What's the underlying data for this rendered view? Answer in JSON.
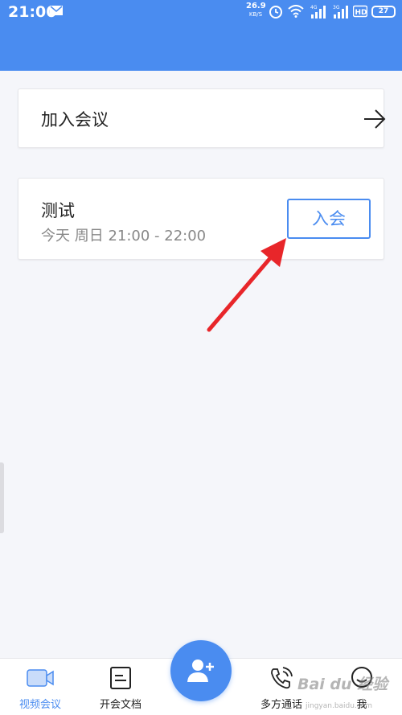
{
  "status_bar": {
    "time": "21:00",
    "net_speed": "26.9",
    "net_speed_unit": "KB/S",
    "battery": "27",
    "signal1_label": "4G",
    "signal2_label": "3G",
    "hd_label": "HD"
  },
  "join_card": {
    "label": "加入会议"
  },
  "meeting_card": {
    "title": "测试",
    "schedule": "今天 周日  21:00 - 22:00",
    "join_button": "入会"
  },
  "tab_bar": {
    "tabs": [
      {
        "label": "视频会议",
        "icon": "video-camera-icon",
        "active": true
      },
      {
        "label": "开会文档",
        "icon": "document-icon",
        "active": false
      },
      {
        "label": "多方通话",
        "icon": "phone-call-icon",
        "active": false
      },
      {
        "label": "我",
        "icon": "profile-icon",
        "active": false
      }
    ],
    "fab_icon": "add-user-icon"
  },
  "watermark": {
    "text": "Bai du 经验",
    "url": "jingyan.baidu.com"
  },
  "colors": {
    "primary": "#4a8cf0",
    "annotation": "#e8262a",
    "background": "#f5f6fa"
  }
}
